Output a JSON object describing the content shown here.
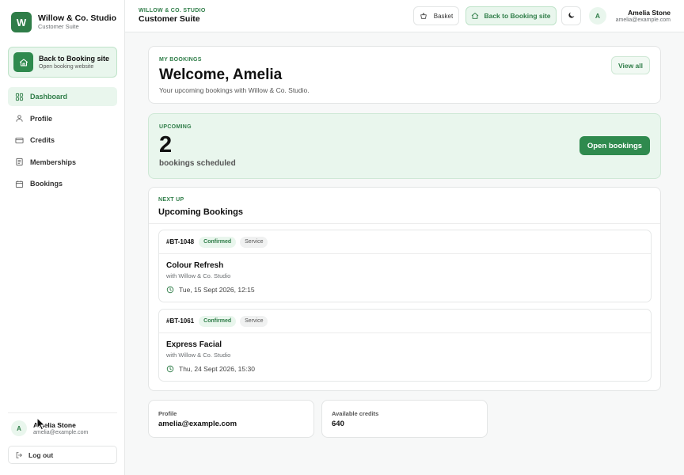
{
  "brand": {
    "initial": "W",
    "name": "Willow & Co. Studio",
    "subtitle": "Customer Suite"
  },
  "sidebar": {
    "back_card": {
      "title": "Back to Booking site",
      "subtitle": "Open booking website"
    },
    "items": [
      {
        "label": "Dashboard",
        "icon": "grid-icon",
        "active": true
      },
      {
        "label": "Profile",
        "icon": "user-icon",
        "active": false
      },
      {
        "label": "Credits",
        "icon": "credit-card-icon",
        "active": false
      },
      {
        "label": "Memberships",
        "icon": "document-icon",
        "active": false
      },
      {
        "label": "Bookings",
        "icon": "calendar-icon",
        "active": false
      }
    ],
    "user": {
      "initial": "A",
      "name": "Amelia Stone",
      "email": "amelia@example.com"
    },
    "logout_label": "Log out"
  },
  "header": {
    "eyebrow": "WILLOW & CO. STUDIO",
    "title": "Customer Suite",
    "basket_label": "Basket",
    "booking_label": "Back to Booking site",
    "user": {
      "initial": "A",
      "name": "Amelia Stone",
      "email": "amelia@example.com"
    }
  },
  "welcome": {
    "eyebrow": "MY BOOKINGS",
    "title": "Welcome, Amelia",
    "subtitle": "Your upcoming bookings with Willow & Co. Studio.",
    "view_all_label": "View all"
  },
  "upcoming": {
    "eyebrow": "UPCOMING",
    "count": "2",
    "label": "bookings scheduled",
    "button_label": "Open bookings"
  },
  "bookings": {
    "eyebrow": "NEXT UP",
    "title": "Upcoming Bookings",
    "items": [
      {
        "id": "#BT-1048",
        "status": "Confirmed",
        "type": "Service",
        "name": "Colour Refresh",
        "with": "with Willow & Co. Studio",
        "datetime": "Tue, 15 Sept 2026, 12:15"
      },
      {
        "id": "#BT-1061",
        "status": "Confirmed",
        "type": "Service",
        "name": "Express Facial",
        "with": "with Willow & Co. Studio",
        "datetime": "Thu, 24 Sept 2026, 15:30"
      }
    ]
  },
  "stats": {
    "profile": {
      "label": "Profile",
      "value": "amelia@example.com"
    },
    "credits": {
      "label": "Available credits",
      "value": "640"
    }
  },
  "colors": {
    "accent": "#2f7d48",
    "accent_light": "#e9f6ed",
    "button": "#2f8a4e"
  }
}
